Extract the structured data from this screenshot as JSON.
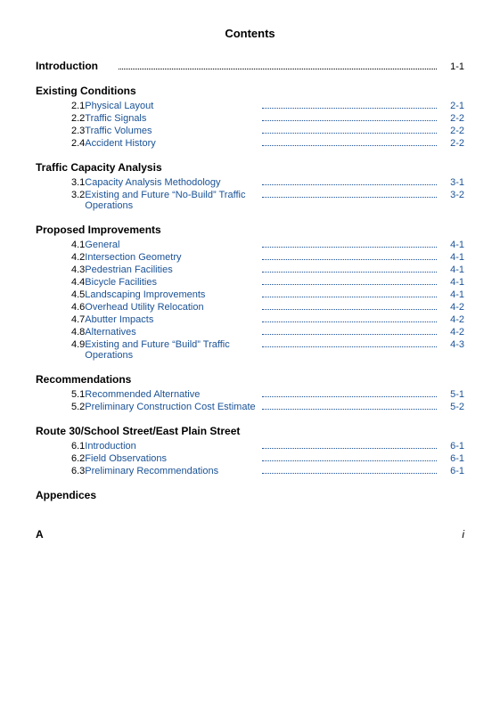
{
  "title": "Contents",
  "introduction": {
    "label": "Introduction",
    "page": "1-1"
  },
  "sections": [
    {
      "heading": "Existing Conditions",
      "entries": [
        {
          "number": "2.1",
          "title": "Physical Layout",
          "page": "2-1"
        },
        {
          "number": "2.2",
          "title": "Traffic Signals",
          "page": "2-2"
        },
        {
          "number": "2.3",
          "title": "Traffic Volumes",
          "page": "2-2"
        },
        {
          "number": "2.4",
          "title": "Accident History",
          "page": "2-2"
        }
      ]
    },
    {
      "heading": "Traffic Capacity Analysis",
      "entries": [
        {
          "number": "3.1",
          "title": "Capacity Analysis Methodology",
          "page": "3-1"
        },
        {
          "number": "3.2",
          "title": "Existing and Future “No-Build” Traffic Operations",
          "page": "3-2"
        }
      ]
    },
    {
      "heading": "Proposed Improvements",
      "entries": [
        {
          "number": "4.1",
          "title": "General",
          "page": "4-1"
        },
        {
          "number": "4.2",
          "title": "Intersection Geometry",
          "page": "4-1"
        },
        {
          "number": "4.3",
          "title": "Pedestrian Facilities",
          "page": "4-1"
        },
        {
          "number": "4.4",
          "title": "Bicycle Facilities",
          "page": "4-1"
        },
        {
          "number": "4.5",
          "title": "Landscaping Improvements",
          "page": "4-1"
        },
        {
          "number": "4.6",
          "title": "Overhead Utility Relocation",
          "page": "4-2"
        },
        {
          "number": "4.7",
          "title": "Abutter Impacts",
          "page": "4-2"
        },
        {
          "number": "4.8",
          "title": "Alternatives",
          "page": "4-2"
        },
        {
          "number": "4.9",
          "title": "Existing and Future “Build” Traffic Operations",
          "page": "4-3"
        }
      ]
    },
    {
      "heading": "Recommendations",
      "entries": [
        {
          "number": "5.1",
          "title": "Recommended Alternative",
          "page": "5-1"
        },
        {
          "number": "5.2",
          "title": "Preliminary Construction Cost Estimate",
          "page": "5-2"
        }
      ]
    },
    {
      "heading": "Route 30/School Street/East Plain Street",
      "entries": [
        {
          "number": "6.1",
          "title": "Introduction",
          "page": "6-1"
        },
        {
          "number": "6.2",
          "title": "Field Observations",
          "page": "6-1"
        },
        {
          "number": "6.3",
          "title": "Preliminary Recommendations",
          "page": "6-1"
        }
      ]
    },
    {
      "heading": "Appendices",
      "entries": []
    }
  ],
  "footer": {
    "left": "A",
    "right": "i"
  }
}
